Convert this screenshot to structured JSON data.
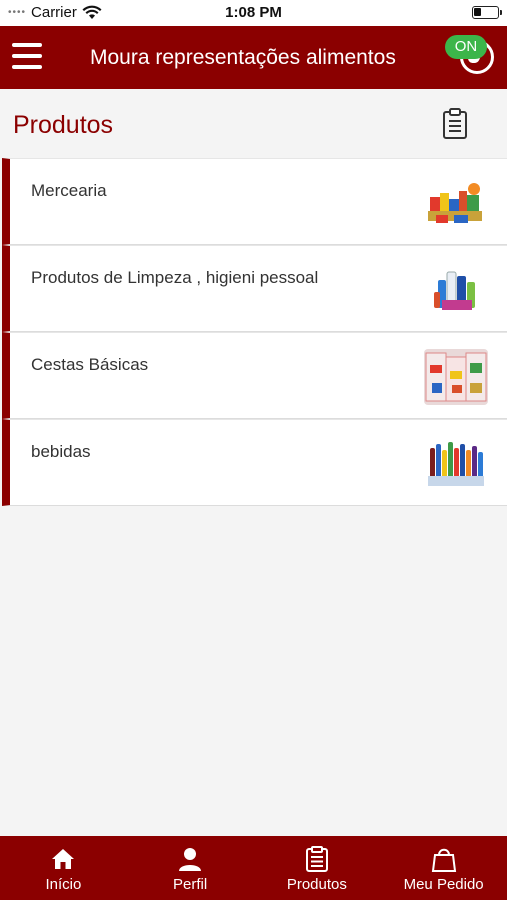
{
  "status_bar": {
    "carrier": "Carrier",
    "time": "1:08 PM"
  },
  "header": {
    "title": "Moura representações alimentos",
    "online_badge": "ON"
  },
  "section": {
    "title": "Produtos"
  },
  "categories": [
    {
      "label": "Mercearia"
    },
    {
      "label": "Produtos de Limpeza , higieni pessoal"
    },
    {
      "label": "Cestas Básicas"
    },
    {
      "label": "bebidas"
    }
  ],
  "tabs": [
    {
      "label": "Início",
      "icon": "home-icon"
    },
    {
      "label": "Perfil",
      "icon": "user-icon"
    },
    {
      "label": "Produtos",
      "icon": "clipboard-icon",
      "active": true
    },
    {
      "label": "Meu Pedido",
      "icon": "shopping-bag-icon"
    }
  ],
  "colors": {
    "brand": "#8b0000",
    "online": "#3cb54a",
    "background": "#f4f4f4"
  }
}
